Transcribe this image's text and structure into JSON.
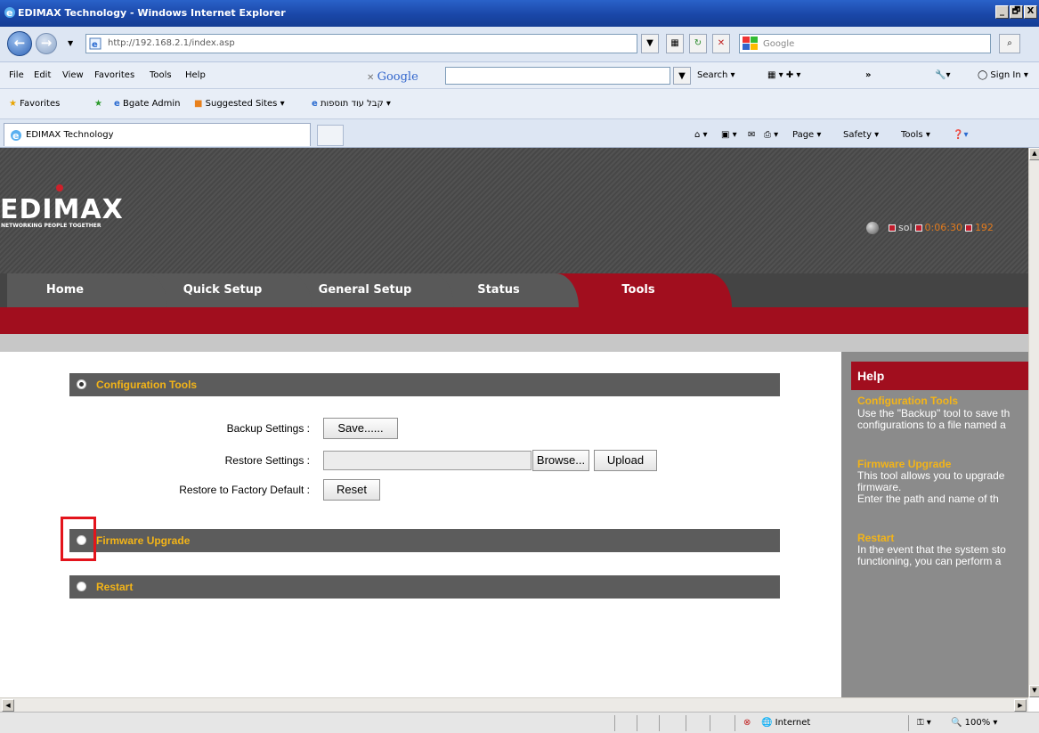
{
  "browser": {
    "window_title": "EDIMAX Technology - Windows Internet Explorer",
    "window_buttons": [
      "_",
      "🗗",
      "X"
    ],
    "url": "http://192.168.2.1/index.asp",
    "search_placeholder": "Google",
    "menu": [
      "File",
      "Edit",
      "View",
      "Favorites",
      "Tools",
      "Help"
    ],
    "google_toolbar_label": "Google",
    "toolbar_search": "Search",
    "toolbar_more": "»",
    "sign_in": "Sign In",
    "favorites_label": "Favorites",
    "favorites": [
      "Bgate Admin",
      "Suggested Sites",
      "קבל עוד תוספות"
    ],
    "tab_title": "EDIMAX Technology",
    "command_bar": [
      "Page",
      "Safety",
      "Tools"
    ],
    "status_zone": "Internet",
    "zoom": "100%"
  },
  "router": {
    "logo": "EDIMAX",
    "tagline": "NETWORKING PEOPLE TOGETHER",
    "header_user": "sol",
    "header_time": "0:06:30",
    "header_ip": "192",
    "nav": [
      "Home",
      "Quick Setup",
      "General Setup",
      "Status",
      "Tools"
    ],
    "active_nav": "Tools",
    "sections": {
      "config": "Configuration Tools",
      "firmware": "Firmware Upgrade",
      "restart": "Restart"
    },
    "backup_label": "Backup Settings :",
    "save_button": "Save......",
    "restore_label": "Restore Settings :",
    "browse_button": "Browse...",
    "upload_button": "Upload",
    "factory_label": "Restore to Factory Default :",
    "reset_button": "Reset"
  },
  "help": {
    "title": "Help",
    "items": [
      {
        "title": "Configuration Tools",
        "lines": [
          "Use the \"Backup\" tool to save th",
          "configurations to a file named a"
        ]
      },
      {
        "title": "Firmware Upgrade",
        "lines": [
          "This tool allows you to upgrade",
          "firmware.",
          "Enter the path and name of th"
        ]
      },
      {
        "title": "Restart",
        "lines": [
          "In the event that the system sto",
          "functioning, you can perform a"
        ]
      }
    ]
  },
  "colors": {
    "accent_red": "#a10e1e",
    "section_title": "#f3b418",
    "section_bg": "#5c5c5c"
  }
}
